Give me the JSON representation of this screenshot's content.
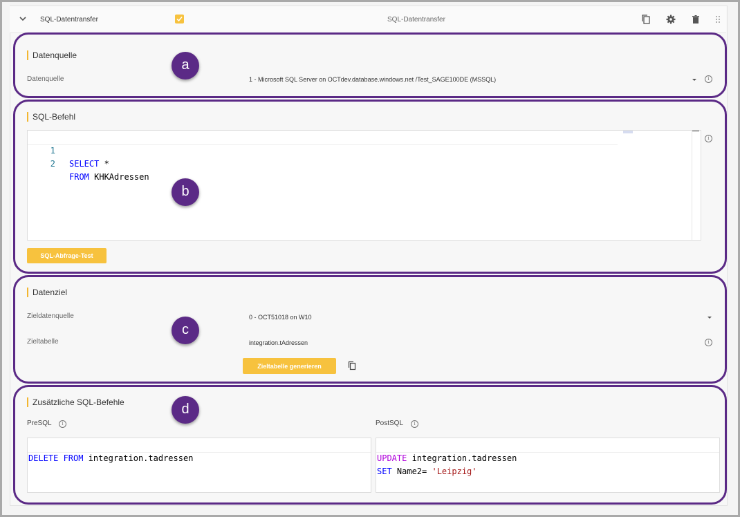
{
  "header": {
    "title": "SQL-Datentransfer",
    "center_label": "SQL-Datentransfer",
    "icons": [
      "chevron-down-icon",
      "checkbox-checked-icon",
      "copy-icon",
      "gear-icon",
      "trash-icon",
      "drag-handle-icon"
    ]
  },
  "section_a": {
    "badge": "a",
    "title": "Datenquelle",
    "field_label": "Datenquelle",
    "field_value": "1 - Microsoft SQL Server on OCTdev.database.windows.net /Test_SAGE100DE (MSSQL)"
  },
  "section_b": {
    "badge": "b",
    "title": "SQL-Befehl",
    "line_numbers": [
      "1",
      "2"
    ],
    "code": [
      {
        "kw": "SELECT",
        "rest": " *"
      },
      {
        "kw": "FROM",
        "rest": " KHKAdressen"
      }
    ],
    "test_button": "SQL-Abfrage-Test"
  },
  "section_c": {
    "badge": "c",
    "title": "Datenziel",
    "target_source_label": "Zieldatenquelle",
    "target_source_value": "0 - OCT51018 on W10",
    "target_table_label": "Zieltabelle",
    "target_table_value": "integration.tAdressen",
    "generate_button": "Zieltabelle generieren"
  },
  "section_d": {
    "badge": "d",
    "title": "Zusätzliche SQL-Befehle",
    "presql_label": "PreSQL",
    "postsql_label": "PostSQL",
    "presql": [
      {
        "kw": "DELETE FROM",
        "rest": " integration.tadressen"
      }
    ],
    "postsql": [
      {
        "kw": "UPDATE",
        "rest": " integration.tadressen"
      },
      {
        "kw": "SET",
        "rest": " Name2= ",
        "str": "'Leipzig'"
      }
    ]
  },
  "colors": {
    "accent": "#f7c23e",
    "annotation": "#5b2a86",
    "keyword_blue": "#0000ff",
    "keyword_purple": "#af00db",
    "string_red": "#a31515"
  }
}
